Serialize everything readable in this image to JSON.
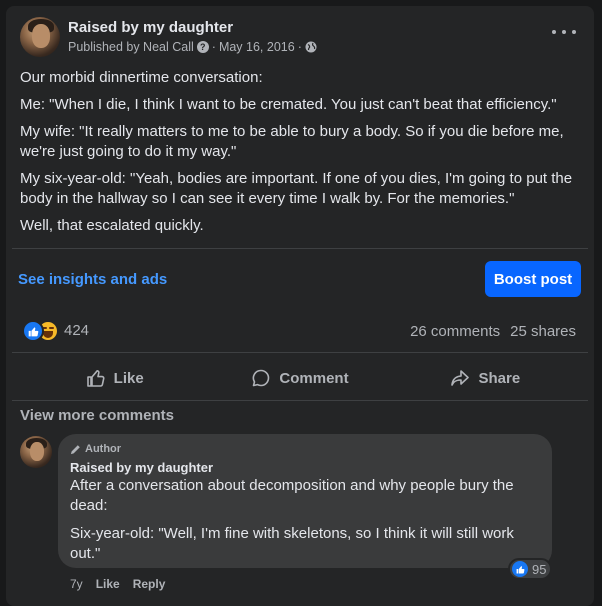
{
  "post": {
    "page_name": "Raised by my daughter",
    "published_by": "Published by Neal Call",
    "question_icon": "?",
    "separator": "·",
    "date": "May 16, 2016",
    "audience_icon": "globe-icon",
    "body": [
      "Our morbid dinnertime conversation:",
      "Me: \"When I die, I think I want to be cremated. You just can't beat that efficiency.\"",
      "My wife: \"It really matters to me to be able to bury a body. So if you die before me, we're just going to do it my way.\"",
      "My six-year-old: \"Yeah, bodies are important. If one of you dies, I'm going to put the body in the hallway so I can see it every time I walk by. For the memories.\"",
      "Well, that escalated quickly."
    ]
  },
  "promo": {
    "insights_link": "See insights and ads",
    "boost_label": "Boost post"
  },
  "engagement": {
    "reaction_icons": [
      "like-icon",
      "haha-icon"
    ],
    "reaction_count": "424",
    "comments": "26 comments",
    "shares": "25 shares"
  },
  "actions": {
    "like": "Like",
    "comment": "Comment",
    "share": "Share"
  },
  "comments_section": {
    "view_more": "View more comments",
    "comment": {
      "badge": "Author",
      "name": "Raised by my daughter",
      "paragraphs": [
        "After a conversation about decomposition and why people bury the dead:",
        "Six-year-old: \"Well, I'm fine with skeletons, so I think it will still work out.\""
      ],
      "time": "7y",
      "like": "Like",
      "reply": "Reply",
      "reaction_count": "95"
    }
  },
  "colors": {
    "background": "#18191a",
    "card": "#242526",
    "bubble": "#3a3b3c",
    "primary_text": "#e4e6eb",
    "secondary_text": "#b0b3b8",
    "link": "#4599ff",
    "boost_button": "#0866ff"
  }
}
